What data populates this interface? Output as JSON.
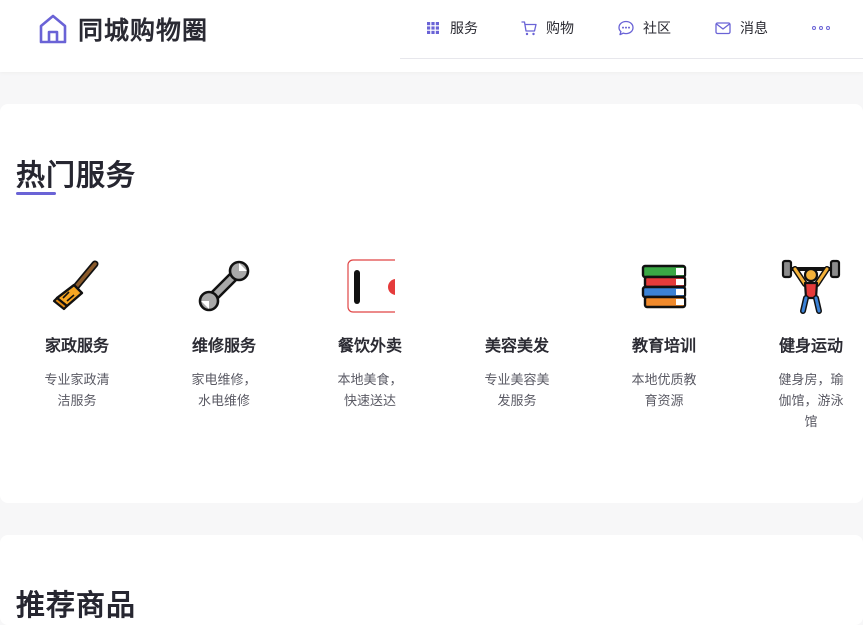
{
  "header": {
    "brand": {
      "title": "同城购物圈",
      "icon": "home-icon"
    },
    "nav": [
      {
        "label": "服务",
        "icon": "grid-icon"
      },
      {
        "label": "购物",
        "icon": "cart-icon"
      },
      {
        "label": "社区",
        "icon": "chat-icon"
      },
      {
        "label": "消息",
        "icon": "mail-icon"
      }
    ],
    "more_icon": "more-dots-icon"
  },
  "hot_services": {
    "title": "热门服务",
    "items": [
      {
        "name": "家政服务",
        "desc": "专业家政清洁服务",
        "icon": "broom-icon"
      },
      {
        "name": "维修服务",
        "desc": "家电维修，水电维修",
        "icon": "wrench-icon"
      },
      {
        "name": "餐饮外卖",
        "desc": "本地美食，快速送达",
        "icon": "food-icon"
      },
      {
        "name": "美容美发",
        "desc": "专业美容美发服务",
        "icon": "beauty-icon"
      },
      {
        "name": "教育培训",
        "desc": "本地优质教育资源",
        "icon": "books-icon"
      },
      {
        "name": "健身运动",
        "desc": "健身房，瑜伽馆，游泳馆",
        "icon": "weightlifting-icon"
      }
    ]
  },
  "recommended": {
    "title": "推荐商品"
  },
  "colors": {
    "accent": "#6a63d6",
    "page_bg": "#f7f7f8",
    "card_bg": "#ffffff",
    "text": "#2b2b33",
    "muted": "#5a5a64"
  }
}
